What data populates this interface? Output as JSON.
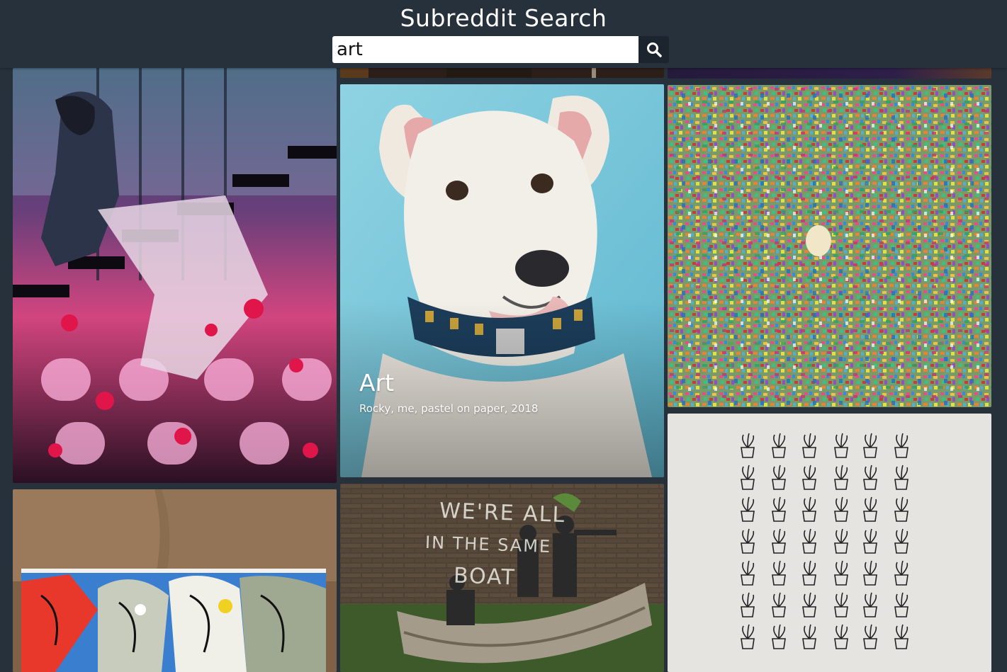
{
  "app": {
    "title": "Subreddit Search"
  },
  "search": {
    "value": "art",
    "placeholder": "",
    "button_icon": "search-icon"
  },
  "posts": [
    {
      "id": "anime-staircase",
      "image": "anime illustration of figures on a staircase with red flowers"
    },
    {
      "id": "dog-pastel",
      "subreddit": "Art",
      "caption": "Rocky, me, pastel on paper, 2018"
    },
    {
      "id": "confetti-crowd",
      "image": "dense colorful crowd doodle"
    },
    {
      "id": "couch-painting",
      "image": "colorful abstract painting on a couch"
    },
    {
      "id": "mural-boat",
      "mural_text_1": "WE'RE ALL",
      "mural_text_2": "IN THE SAME",
      "mural_text_3": "BOAT"
    },
    {
      "id": "plants-grid",
      "image": "grid of potted plant ink drawings"
    },
    {
      "id": "top-middle-partial",
      "image": "cropped dark image"
    },
    {
      "id": "top-right-partial",
      "image": "cropped dark purple image"
    }
  ],
  "colors": {
    "header_bg": "#26313b",
    "page_bg": "#27313b",
    "search_button_bg": "#1c252d"
  }
}
